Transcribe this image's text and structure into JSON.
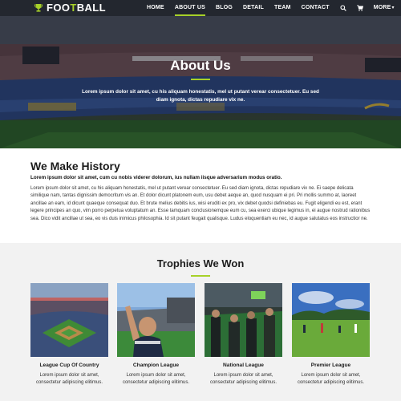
{
  "brand": {
    "name_prefix": "FOO",
    "name_accent": "T",
    "name_suffix": "BALL"
  },
  "nav": {
    "items": [
      {
        "label": "HOME"
      },
      {
        "label": "ABOUT US",
        "active": true
      },
      {
        "label": "BLOG"
      },
      {
        "label": "DETAIL"
      },
      {
        "label": "TEAM"
      },
      {
        "label": "CONTACT"
      }
    ],
    "more_label": "MORE",
    "icons": [
      "search-icon",
      "cart-icon",
      "menu-icon"
    ]
  },
  "hero": {
    "title": "About Us",
    "text": "Lorem ipsum dolor sit amet, cu his aliquam honestatis, mel ut putant verear consectetuer. Eu sed diam ignota, dictas repudiare vix ne."
  },
  "history": {
    "title": "We Make History",
    "lead": "Lorem ipsum dolor sit amet, cum cu nobis viderer dolorum, ius nullam iisque adversarium modus oratio.",
    "body": "Lorem ipsum dolor sit amet, cu his aliquam honestatis, mel ut putant verear consectetuer. Eu sed diam ignota, dictas repudiare vix ne. Ei saepe delicata similique nam, tantas dignissim democritum vis an. Et dolor dicunt platonem eum, usu debet aeque an, quod nusquam ei pri. Pri mollis summo at, laoreet ancillae an eam, id dicunt quaeque consequat duo. Et brute melius debitis ius, wisi eruditi ex pro, vix debet quodsi definiebas eu. Fugit eligendi eu est, erant legere principes an quo, vim porro perpetua voluptatum an. Esse tamquam conclusionemque eum cu, sea exerci ubique legimus in, ei augue nostrud rationibus sea. Dico vidit ancillae ut sea, eo vis duis inimicus philosophia. Id sit putant feugait qualisque. Ludus eloquentiam eu nec, id augue salutatus eos instructior ne."
  },
  "trophies": {
    "title": "Trophies We Won",
    "cards": [
      {
        "title": "League Cup Of Country",
        "text": "Lorem ipsum dolor sit amet, consectetur adipiscing elitimus."
      },
      {
        "title": "Champion League",
        "text": "Lorem ipsum dolor sit amet, consectetur adipiscing elitimus."
      },
      {
        "title": "National League",
        "text": "Lorem ipsum dolor sit amet, consectetur adipiscing elitimus."
      },
      {
        "title": "Premier League",
        "text": "Lorem ipsum dolor sit amet, consectetur adipiscing elitimus."
      }
    ]
  },
  "colors": {
    "accent": "#a7d129",
    "dark": "#1c1c1c",
    "section_bg": "#f2f2f2"
  }
}
